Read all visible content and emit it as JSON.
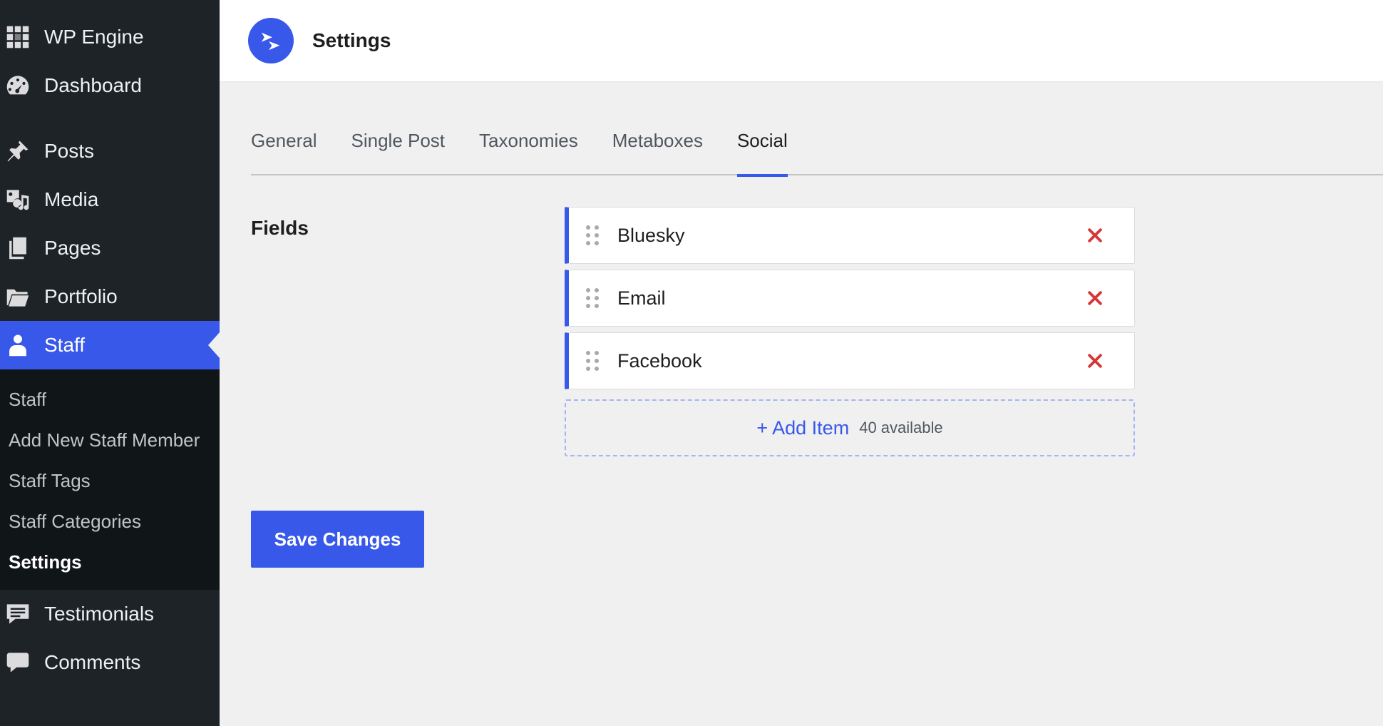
{
  "sidebar": {
    "items": [
      {
        "label": "WP Engine",
        "icon": "wp-engine-icon"
      },
      {
        "label": "Dashboard",
        "icon": "dashboard-icon"
      },
      {
        "label": "Posts",
        "icon": "pushpin-icon"
      },
      {
        "label": "Media",
        "icon": "media-icon"
      },
      {
        "label": "Pages",
        "icon": "pages-icon"
      },
      {
        "label": "Portfolio",
        "icon": "folder-icon"
      },
      {
        "label": "Staff",
        "icon": "staff-icon"
      },
      {
        "label": "Testimonials",
        "icon": "testimonials-icon"
      },
      {
        "label": "Comments",
        "icon": "comments-icon"
      }
    ],
    "submenu": [
      "Staff",
      "Add New Staff Member",
      "Staff Tags",
      "Staff Categories",
      "Settings"
    ],
    "active_item": "Staff",
    "current_submenu": "Settings"
  },
  "header": {
    "title": "Settings",
    "logo_icon": "plugin-logo-icon"
  },
  "tabs": [
    {
      "label": "General"
    },
    {
      "label": "Single Post"
    },
    {
      "label": "Taxonomies"
    },
    {
      "label": "Metaboxes"
    },
    {
      "label": "Social",
      "active": true
    }
  ],
  "fields": {
    "label": "Fields",
    "items": [
      {
        "name": "Bluesky"
      },
      {
        "name": "Email"
      },
      {
        "name": "Facebook"
      }
    ],
    "add_label": "+ Add Item",
    "available": "40 available"
  },
  "save_label": "Save Changes",
  "colors": {
    "accent": "#3858e9",
    "sidebar_bg": "#1d2327",
    "submenu_bg": "#101517",
    "remove": "#d63638",
    "page_bg": "#f0f0f1"
  }
}
